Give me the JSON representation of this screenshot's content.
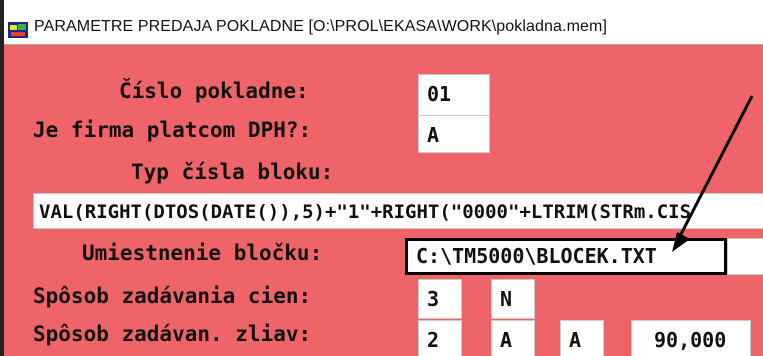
{
  "window": {
    "title": "PARAMETRE PREDAJA POKLADNE  [O:\\PROL\\EKASA\\WORK\\pokladna.mem]",
    "icon": "app-icon"
  },
  "form": {
    "cislo_pokladne": {
      "label": "Číslo pokladne:",
      "value": "01"
    },
    "platca_dph": {
      "label": "Je firma platcom DPH?:",
      "value": "A"
    },
    "typ_cisla_bloku": {
      "label": "Typ čísla bloku:",
      "value": "VAL(RIGHT(DTOS(DATE()),5)+\"1\"+RIGHT(\"0000\"+LTRIM(STRm.CIS"
    },
    "umiestnenie_blocku": {
      "label": "Umiestnenie bločku:",
      "value": "C:\\TM5000\\BLOCEK.TXT"
    },
    "sposob_cien": {
      "label": "Spôsob zadávania cien:",
      "value1": "3",
      "value2": "N"
    },
    "sposob_zliav": {
      "label": "Spôsob zadávan. zliav:",
      "value1": "2",
      "value2": "A",
      "value3": "A",
      "value4": "90,000"
    }
  },
  "colors": {
    "background": "#ef6468",
    "field": "#ffffff",
    "titlebar": "#ffffff",
    "annotation": "#000000"
  }
}
